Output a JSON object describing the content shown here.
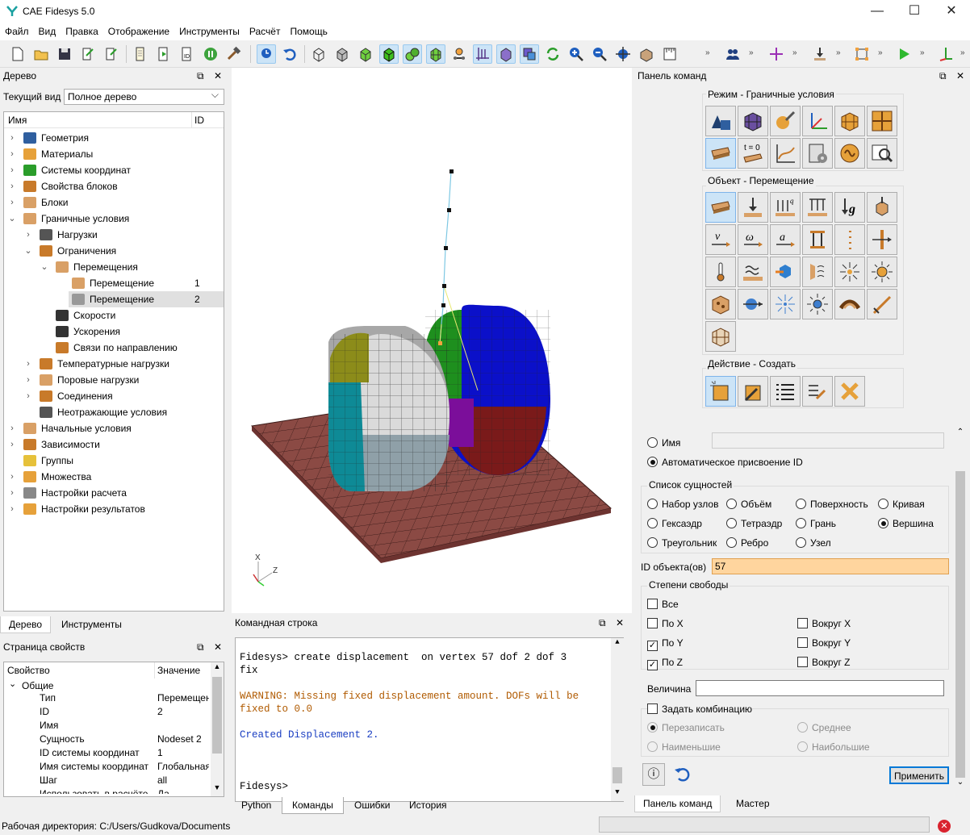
{
  "app": {
    "title": "CAE Fidesys 5.0"
  },
  "menu": [
    "Файл",
    "Вид",
    "Правка",
    "Отображение",
    "Инструменты",
    "Расчёт",
    "Помощь"
  ],
  "tree_panel": {
    "title": "Дерево",
    "view_label": "Текущий вид",
    "view_value": "Полное дерево",
    "col_name": "Имя",
    "col_id": "ID",
    "items": [
      {
        "label": "Геометрия",
        "id": ""
      },
      {
        "label": "Материалы",
        "id": ""
      },
      {
        "label": "Системы координат",
        "id": ""
      },
      {
        "label": "Свойства блоков",
        "id": ""
      },
      {
        "label": "Блоки",
        "id": ""
      },
      {
        "label": "Граничные условия",
        "id": ""
      },
      {
        "label": "Нагрузки",
        "id": ""
      },
      {
        "label": "Ограничения",
        "id": ""
      },
      {
        "label": "Перемещения",
        "id": ""
      },
      {
        "label": "Перемещение",
        "id": "1"
      },
      {
        "label": "Перемещение",
        "id": "2"
      },
      {
        "label": "Скорости",
        "id": ""
      },
      {
        "label": "Ускорения",
        "id": ""
      },
      {
        "label": "Связи по направлению",
        "id": ""
      },
      {
        "label": "Температурные нагрузки",
        "id": ""
      },
      {
        "label": "Поровые нагрузки",
        "id": ""
      },
      {
        "label": "Соединения",
        "id": ""
      },
      {
        "label": "Неотражающие условия",
        "id": ""
      },
      {
        "label": "Начальные условия",
        "id": ""
      },
      {
        "label": "Зависимости",
        "id": ""
      },
      {
        "label": "Группы",
        "id": ""
      },
      {
        "label": "Множества",
        "id": ""
      },
      {
        "label": "Настройки расчета",
        "id": ""
      },
      {
        "label": "Настройки результатов",
        "id": ""
      }
    ],
    "tabs": [
      "Дерево",
      "Инструменты"
    ]
  },
  "prop_panel": {
    "title": "Страница свойств",
    "col_prop": "Свойство",
    "col_value": "Значение",
    "group": "Общие",
    "rows": [
      {
        "k": "Тип",
        "v": "Перемещен"
      },
      {
        "k": "ID",
        "v": "2"
      },
      {
        "k": "Имя",
        "v": ""
      },
      {
        "k": "Сущность",
        "v": "Nodeset 2"
      },
      {
        "k": "ID системы координат",
        "v": "1"
      },
      {
        "k": "Имя системы координат",
        "v": "Глобальная"
      },
      {
        "k": "Шаг",
        "v": "all"
      },
      {
        "k": "Использовать в расчёте",
        "v": "Да"
      }
    ]
  },
  "viewport": {
    "axis_x": "X",
    "axis_z": "Z"
  },
  "cmd_panel": {
    "title": "Командная строка",
    "lines": [
      {
        "text": "Fidesys> create displacement  on vertex 57 dof 2 dof 3",
        "kind": "prompt"
      },
      {
        "text": "fix",
        "kind": "prompt"
      },
      {
        "text": "WARNING: Missing fixed displacement amount. DOFs will be",
        "kind": "warn"
      },
      {
        "text": "fixed to 0.0",
        "kind": "warn"
      },
      {
        "text": "Created Displacement 2.",
        "kind": "info"
      },
      {
        "text": "Fidesys>",
        "kind": "prompt"
      }
    ],
    "tabs": [
      "Python",
      "Команды",
      "Ошибки",
      "История"
    ]
  },
  "right_panel": {
    "title": "Панель команд",
    "mode_title": "Режим - Граничные условия",
    "object_title": "Объект - Перемещение",
    "action_title": "Действие - Создать",
    "t0_label": "t = 0",
    "name_radio": "Имя",
    "auto_id_radio": "Автоматическое присвоение ID",
    "entity_list_title": "Список сущностей",
    "entities": [
      "Набор узлов",
      "Объём",
      "Поверхность",
      "Кривая",
      "Гексаэдр",
      "Тетраэдр",
      "Грань",
      "Вершина",
      "Треугольник",
      "Ребро",
      "Узел"
    ],
    "entity_selected": "Вершина",
    "ids_label": "ID объекта(ов)",
    "ids_value": "57",
    "dof_title": "Степени свободы",
    "dof_all": "Все",
    "dof": [
      {
        "label": "По X",
        "checked": false
      },
      {
        "label": "Вокруг X",
        "checked": false
      },
      {
        "label": "По Y",
        "checked": true
      },
      {
        "label": "Вокруг Y",
        "checked": false
      },
      {
        "label": "По Z",
        "checked": true
      },
      {
        "label": "Вокруг Z",
        "checked": false
      }
    ],
    "magnitude_label": "Величина",
    "combo_label": "Задать комбинацию",
    "combo_opts": [
      "Перезаписать",
      "Среднее",
      "Наименьшие",
      "Наибольшие"
    ],
    "apply": "Применить",
    "tabs": [
      "Панель команд",
      "Мастер"
    ]
  },
  "status": {
    "workdir": "Рабочая директория: C:/Users/Gudkova/Documents"
  },
  "colors": {
    "accent": "#cce4f7",
    "ids_field": "#ffd59e",
    "warn": "#b05a00",
    "info": "#1a3ec2"
  }
}
